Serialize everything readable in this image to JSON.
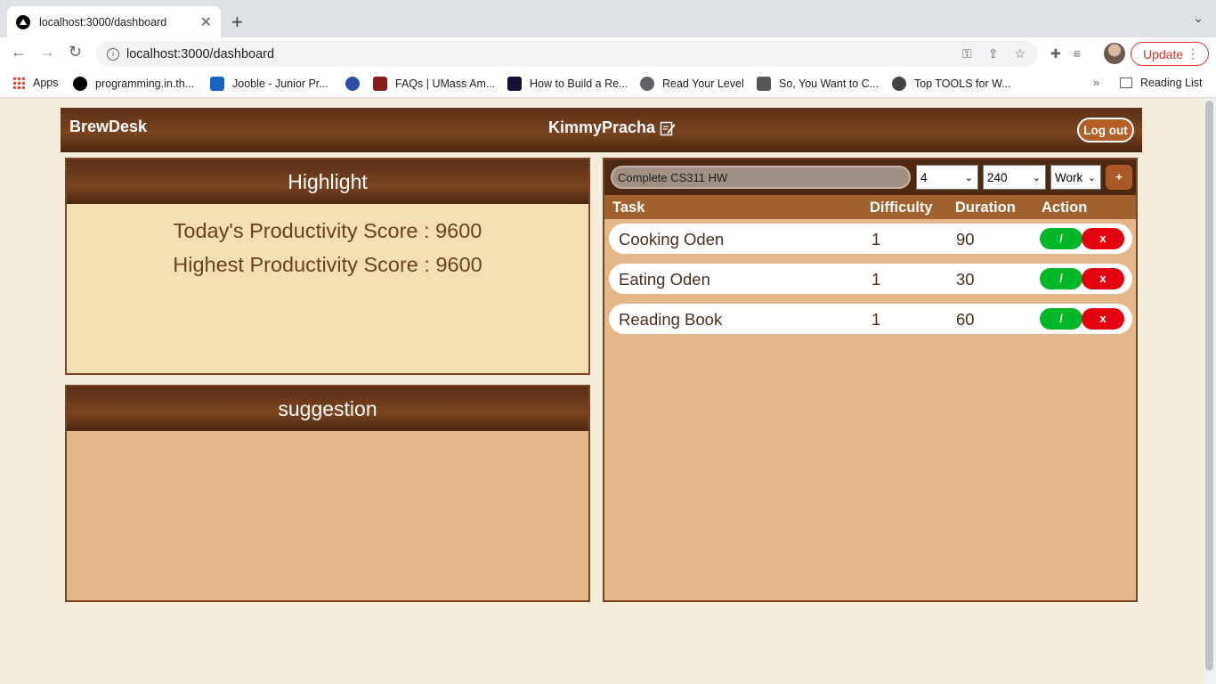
{
  "browser": {
    "tab_title": "localhost:3000/dashboard",
    "url": "localhost:3000/dashboard",
    "update_label": "Update",
    "reading_list_label": "Reading List",
    "bookmarks": [
      {
        "label": "Apps",
        "icon": "apps-grid-icon"
      },
      {
        "label": "programming.in.th...",
        "icon": "p-logo-icon",
        "color": "#000000"
      },
      {
        "label": "Jooble - Junior Pr...",
        "icon": "j-logo-icon",
        "color": "#1565c0"
      },
      {
        "label": "",
        "icon": "globe-badge-icon",
        "color": "#2a4fa8"
      },
      {
        "label": "FAQs | UMass Am...",
        "icon": "m-logo-icon",
        "color": "#881c1c"
      },
      {
        "label": "How to Build a Re...",
        "icon": "code-logo-icon",
        "color": "#111133"
      },
      {
        "label": "Read Your Level",
        "icon": "globe-icon",
        "color": "#5f6368"
      },
      {
        "label": "So, You Want to C...",
        "icon": "h-logo-icon",
        "color": "#555555"
      },
      {
        "label": "Top TOOLS for W...",
        "icon": "gear-logo-icon",
        "color": "#444444"
      }
    ]
  },
  "app": {
    "brand": "BrewDesk",
    "username": "KimmyPracha",
    "logout_label": "Log out"
  },
  "highlight": {
    "title": "Highlight",
    "today_score": "Today's Productivity Score : 9600",
    "highest_score": "Highest Productivity Score : 9600"
  },
  "suggestion": {
    "title": "suggestion"
  },
  "task_form": {
    "task_value": "Complete CS311 HW",
    "difficulty_value": "4",
    "duration_value": "240",
    "category_value": "Work",
    "add_label": "+"
  },
  "table": {
    "headers": [
      "Task",
      "Difficulty",
      "Duration",
      "Action"
    ],
    "done_label": "/",
    "delete_label": "x",
    "rows": [
      {
        "task": "Cooking Oden",
        "difficulty": "1",
        "duration": "90"
      },
      {
        "task": "Eating Oden",
        "difficulty": "1",
        "duration": "30"
      },
      {
        "task": "Reading Book",
        "difficulty": "1",
        "duration": "60"
      }
    ]
  },
  "colors": {
    "page_bg": "#f5ecd9",
    "header_brown": "#5b2f17",
    "panel_tan": "#e5b689",
    "highlight_bg": "#f4dfb5",
    "done_green": "#00b727",
    "delete_red": "#e3000f"
  }
}
